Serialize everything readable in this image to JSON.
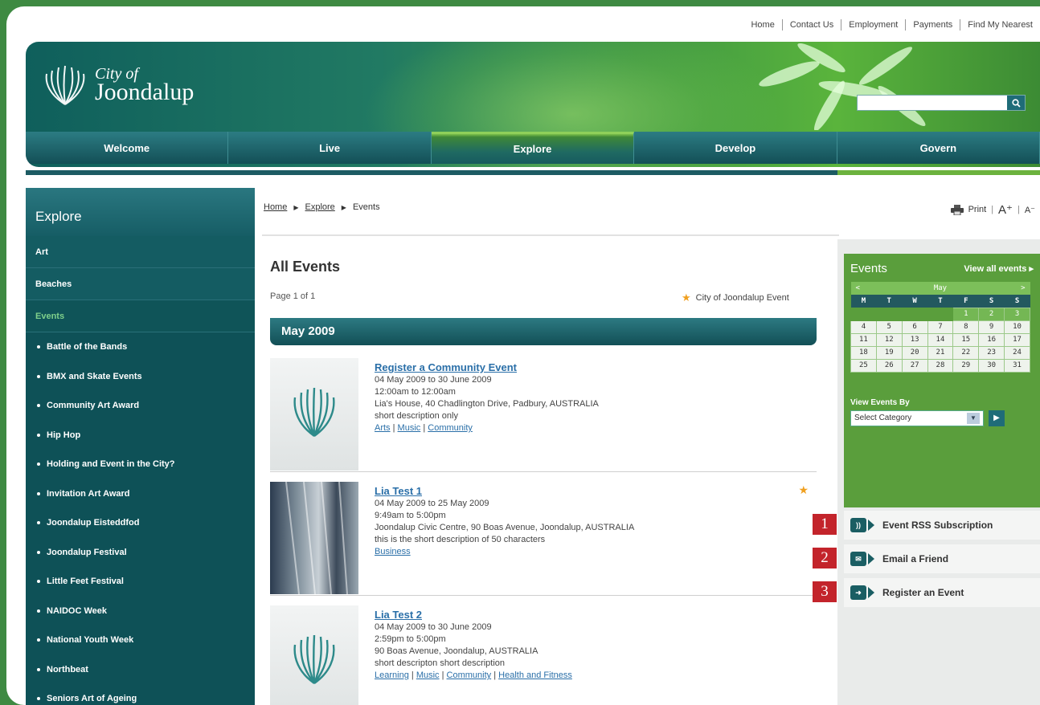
{
  "toplinks": [
    "Home",
    "Contact Us",
    "Employment",
    "Payments",
    "Find My Nearest"
  ],
  "logo": {
    "line1": "City of",
    "line2": "Joondalup"
  },
  "search": {
    "placeholder": ""
  },
  "nav": [
    "Welcome",
    "Live",
    "Explore",
    "Develop",
    "Govern"
  ],
  "sidebar": {
    "title": "Explore",
    "sections": [
      "Art",
      "Beaches",
      "Events"
    ],
    "items": [
      "Battle of the Bands",
      "BMX and Skate Events",
      "Community Art Award",
      "Hip Hop",
      "Holding and Event in the City?",
      "Invitation Art Award",
      "Joondalup Eisteddfod",
      "Joondalup Festival",
      "Little Feet Festival",
      "NAIDOC Week",
      "National Youth Week",
      "Northbeat",
      "Seniors Art of Ageing"
    ]
  },
  "breadcrumb": {
    "home": "Home",
    "explore": "Explore",
    "current": "Events"
  },
  "tools": {
    "print": "Print",
    "increase": "A⁺",
    "decrease": "A⁻"
  },
  "main": {
    "title": "All Events",
    "page": "Page 1 of 1",
    "legend": "City of Joondalup Event",
    "month": "May 2009"
  },
  "events": [
    {
      "title": "Register a Community Event",
      "dates": "04 May 2009 to 30 June 2009",
      "time": "12:00am to 12:00am",
      "location": "Lia's House, 40 Chadlington Drive, Padbury, AUSTRALIA",
      "desc": "short description only",
      "cats": [
        "Arts",
        "Music",
        "Community"
      ]
    },
    {
      "title": "Lia Test 1",
      "dates": "04 May 2009 to 25 May 2009",
      "time": "9:49am to 5:00pm",
      "location": "Joondalup Civic Centre, 90 Boas Avenue, Joondalup, AUSTRALIA",
      "desc": "this is the short description of 50 characters",
      "cats": [
        "Business"
      ]
    },
    {
      "title": "Lia Test 2",
      "dates": "04 May 2009 to 30 June 2009",
      "time": "2:59pm to 5:00pm",
      "location": "90 Boas Avenue, Joondalup, AUSTRALIA",
      "desc": "short descripton short description",
      "cats": [
        "Learning",
        "Music",
        "Community",
        "Health and Fitness"
      ]
    }
  ],
  "calendar": {
    "title": "Events",
    "view_all": "View all events ▸",
    "prev": "<",
    "month": "May",
    "next": ">",
    "dow": [
      "M",
      "T",
      "W",
      "T",
      "F",
      "S",
      "S"
    ],
    "weeks": [
      [
        "",
        "",
        "",
        "",
        "1",
        "2",
        "3"
      ],
      [
        "4",
        "5",
        "6",
        "7",
        "8",
        "9",
        "10"
      ],
      [
        "11",
        "12",
        "13",
        "14",
        "15",
        "16",
        "17"
      ],
      [
        "18",
        "19",
        "20",
        "21",
        "22",
        "23",
        "24"
      ],
      [
        "25",
        "26",
        "27",
        "28",
        "29",
        "30",
        "31"
      ]
    ],
    "view_by": "View Events By",
    "select": "Select Category"
  },
  "actions": [
    {
      "label": "Event RSS Subscription",
      "badge": "1"
    },
    {
      "label": "Email a Friend",
      "badge": "2"
    },
    {
      "label": "Register an Event",
      "badge": "3"
    }
  ],
  "colors": {
    "page_green": "#3e8a42",
    "teal": "#0e5157",
    "link": "#2a6fa8",
    "badge_red": "#c3242b"
  }
}
